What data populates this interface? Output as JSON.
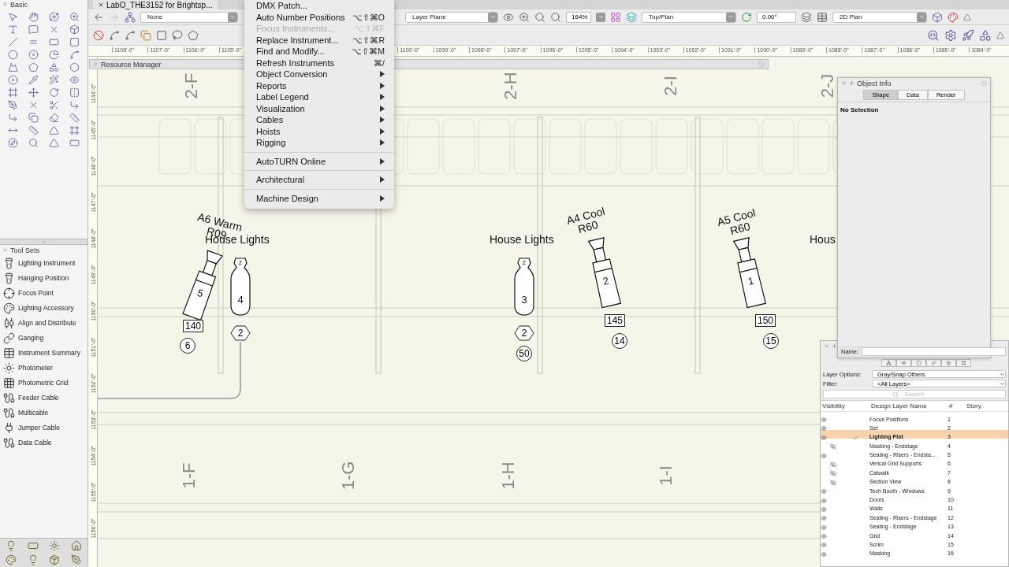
{
  "document_tab": {
    "title": "LabO_THE3152 for Brightsp..."
  },
  "view_bar": {
    "class_dropdown": "None",
    "layer_plane": "Layer Plane",
    "zoom": "164%",
    "view": "Top/Plan",
    "rotation": "0.00°",
    "render_mode": "2D Plan"
  },
  "ruler_h": [
    "1108'-0\"",
    "1107'-0\"",
    "1106'-0\"",
    "1105'-0\"",
    "1100'-0\"",
    "1099'-0\"",
    "1098'-0\"",
    "1097'-0\"",
    "1096'-0\"",
    "1095'-0\"",
    "1094'-0\"",
    "1093'-0\"",
    "1092'-0\"",
    "1091'-0\"",
    "1090'-0\"",
    "1089'-0\"",
    "1088'-0\"",
    "1087'-0\"",
    "1086'-0\"",
    "1085'-0\"",
    "1084'-0\""
  ],
  "ruler_v": [
    "1144'-0\"",
    "1145'-0\"",
    "1146'-0\"",
    "1147'-0\"",
    "1148'-0\"",
    "1149'-0\"",
    "1150'-0\"",
    "1151'-0\"",
    "1152'-0\"",
    "1153'-0\"",
    "1154'-0\"",
    "1155'-0\"",
    "1156'-0\""
  ],
  "resource_manager": {
    "title": "Resource Manager"
  },
  "basic_palette": {
    "title": "Basic"
  },
  "tool_sets": {
    "title": "Tool Sets",
    "items": [
      "Lighting Instrument",
      "Hanging Position",
      "Focus Point",
      "Lighting Accessory",
      "Align and Distribute",
      "Ganging",
      "Instrument Summary",
      "Photometer",
      "Photometric Grid",
      "Feeder Cable",
      "Multicable",
      "Jumper Cable",
      "Data Cable"
    ]
  },
  "menu": {
    "items": [
      {
        "kind": "command",
        "label": "DMX Patch...",
        "disabled": false
      },
      {
        "kind": "command",
        "label": "Auto Number Positions",
        "shortcut": "⌥⇧⌘O",
        "disabled": false
      },
      {
        "kind": "command",
        "label": "Focus Instruments...",
        "shortcut": "⌥⇧⌘F",
        "disabled": true
      },
      {
        "kind": "command",
        "label": "Replace Instrument...",
        "shortcut": "⌥⇧⌘R",
        "disabled": false
      },
      {
        "kind": "command",
        "label": "Find and Modify...",
        "shortcut": "⌥⇧⌘M",
        "disabled": false
      },
      {
        "kind": "command",
        "label": "Refresh Instruments",
        "shortcut": "⌘/",
        "disabled": false
      },
      {
        "kind": "submenu",
        "label": "Object Conversion"
      },
      {
        "kind": "submenu",
        "label": "Reports"
      },
      {
        "kind": "submenu",
        "label": "Label Legend"
      },
      {
        "kind": "submenu",
        "label": "Visualization"
      },
      {
        "kind": "submenu",
        "label": "Cables"
      },
      {
        "kind": "submenu",
        "label": "Hoists"
      },
      {
        "kind": "submenu",
        "label": "Rigging"
      },
      {
        "kind": "separator"
      },
      {
        "kind": "submenu",
        "label": "AutoTURN Online"
      },
      {
        "kind": "separator"
      },
      {
        "kind": "submenu",
        "label": "Architectural"
      },
      {
        "kind": "separator"
      },
      {
        "kind": "submenu",
        "label": "Machine Design"
      }
    ]
  },
  "canvas": {
    "grid_labels": [
      "2-F",
      "2-H",
      "2-I",
      "2-J",
      "1-F",
      "1-G",
      "1-H",
      "1-I"
    ],
    "position_labels": [
      "House Lights",
      "House Lights",
      "Hous"
    ],
    "instruments": [
      {
        "kind": "spot",
        "purpose": "A6 Warm",
        "gel": "R09",
        "unit": "5",
        "channel": "140",
        "dimmer": "6"
      },
      {
        "kind": "house",
        "type": "Z",
        "unit": "4",
        "circuit": "2"
      },
      {
        "kind": "house",
        "type": "Z",
        "unit": "3",
        "circuit": "2",
        "dimmer": "50"
      },
      {
        "kind": "spot",
        "purpose": "A4 Cool",
        "gel": "R60",
        "unit": "2",
        "channel": "145",
        "dimmer": "14"
      },
      {
        "kind": "spot",
        "purpose": "A5 Cool",
        "gel": "R60",
        "unit": "1",
        "channel": "150",
        "dimmer": "15"
      }
    ]
  },
  "object_info": {
    "title": "Object Info",
    "tabs": [
      {
        "label": "Shape",
        "selected": true
      },
      {
        "label": "Data",
        "selected": false
      },
      {
        "label": "Render",
        "selected": false
      }
    ],
    "selection": "No Selection",
    "name_label": "Name:"
  },
  "layers": {
    "options_label": "Layer Options:",
    "options_value": "Gray/Snap Others",
    "filter_label": "Filter:",
    "filter_value": "<All Layers>",
    "search_placeholder": "Search",
    "columns": [
      "Visibility",
      "Design Layer Name",
      "#",
      "Story"
    ],
    "rows": [
      {
        "name": "Focus Positions",
        "number": "1",
        "visible": true,
        "selected": false
      },
      {
        "name": "Set",
        "number": "2",
        "visible": true,
        "selected": false
      },
      {
        "name": "Lighting Plot",
        "number": "3",
        "visible": true,
        "selected": true
      },
      {
        "name": "Masking - Endstage",
        "number": "4",
        "visible": false,
        "selected": false
      },
      {
        "name": "Seating - Risers - Endsta...",
        "number": "5",
        "visible": true,
        "selected": false
      },
      {
        "name": "Verical Grid Supports",
        "number": "6",
        "visible": false,
        "selected": false
      },
      {
        "name": "Catwalk",
        "number": "7",
        "visible": false,
        "selected": false
      },
      {
        "name": "Section View",
        "number": "8",
        "visible": false,
        "selected": false
      },
      {
        "name": "Tech Booth - Windows",
        "number": "9",
        "visible": true,
        "selected": false
      },
      {
        "name": "Doors",
        "number": "10",
        "visible": true,
        "selected": false
      },
      {
        "name": "Walls",
        "number": "11",
        "visible": true,
        "selected": false
      },
      {
        "name": "Seating - Risers - Endstage",
        "number": "12",
        "visible": true,
        "selected": false
      },
      {
        "name": "Seating - Endstage",
        "number": "13",
        "visible": true,
        "selected": false
      },
      {
        "name": "Grid",
        "number": "14",
        "visible": true,
        "selected": false
      },
      {
        "name": "Scrim",
        "number": "15",
        "visible": true,
        "selected": false
      },
      {
        "name": "Masking",
        "number": "16",
        "visible": true,
        "selected": false
      }
    ]
  }
}
